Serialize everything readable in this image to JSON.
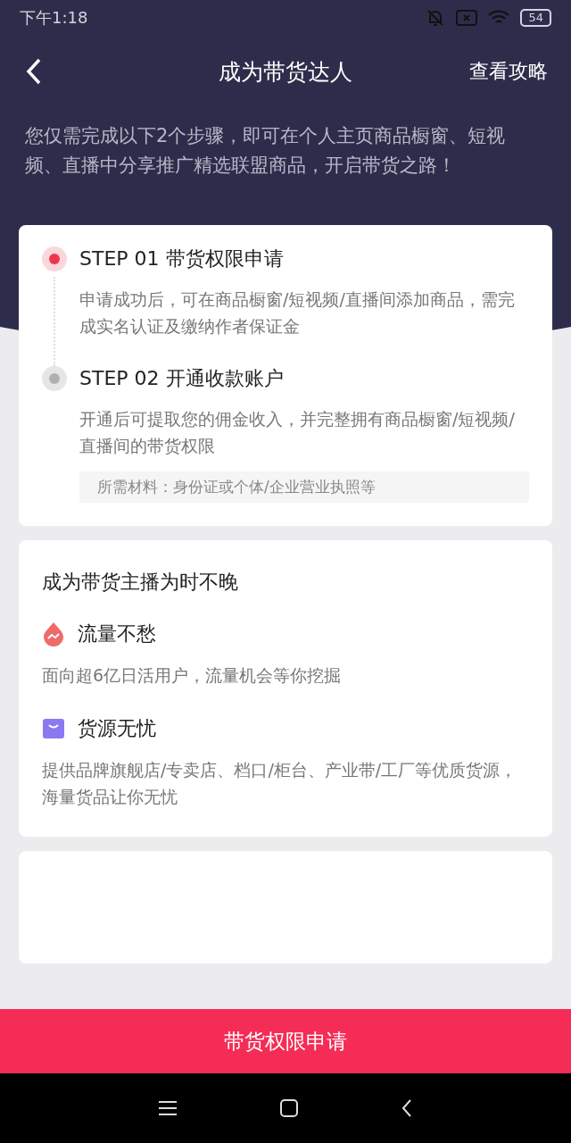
{
  "status_bar": {
    "time": "下午1:18",
    "battery": "54"
  },
  "header": {
    "title": "成为带货达人",
    "action": "查看攻略"
  },
  "intro": "您仅需完成以下2个步骤，即可在个人主页商品橱窗、短视频、直播中分享推广精选联盟商品，开启带货之路！",
  "steps": [
    {
      "title": "STEP 01 带货权限申请",
      "description": "申请成功后，可在商品橱窗/短视频/直播间添加商品，需完成实名认证及缴纳作者保证金",
      "active": true
    },
    {
      "title": "STEP 02 开通收款账户",
      "description": "开通后可提取您的佣金收入，并完整拥有商品橱窗/短视频/直播间的带货权限",
      "note": "所需材料：身份证或个体/企业营业执照等",
      "active": false
    }
  ],
  "benefits": {
    "title": "成为带货主播为时不晚",
    "items": [
      {
        "kind": "traffic",
        "title": "流量不愁",
        "description": "面向超6亿日活用户，流量机会等你挖掘"
      },
      {
        "kind": "goods",
        "title": "货源无忧",
        "description": "提供品牌旗舰店/专卖店、档口/柜台、产业带/工厂等优质货源，海量货品让你无忧"
      }
    ]
  },
  "apply_button": "带货权限申请"
}
